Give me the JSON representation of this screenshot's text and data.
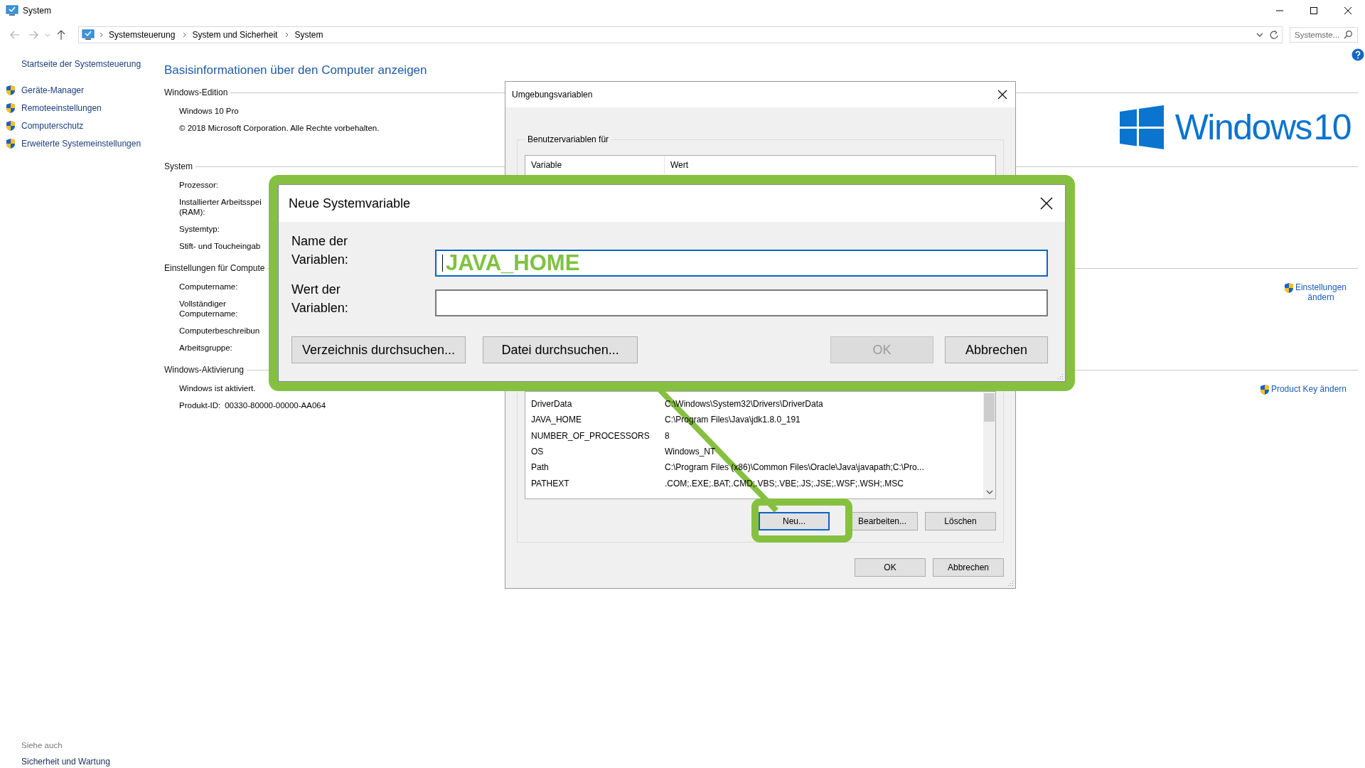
{
  "window": {
    "title": "System"
  },
  "address_bar": {
    "breadcrumbs": [
      "Systemsteuerung",
      "System und Sicherheit",
      "System"
    ]
  },
  "search": {
    "placeholder": "Systemste..."
  },
  "sidebar": {
    "home_link": "Startseite der Systemsteuerung",
    "items": [
      "Geräte-Manager",
      "Remoteeinstellungen",
      "Computerschutz",
      "Erweiterte Systemeinstellungen"
    ],
    "see_also": {
      "heading": "Siehe auch",
      "links": [
        "Sicherheit und Wartung"
      ]
    }
  },
  "main": {
    "heading": "Basisinformationen über den Computer anzeigen",
    "sections": [
      {
        "title": "Windows-Edition",
        "rows": [
          {
            "label": "Windows 10 Pro"
          },
          {
            "label": "© 2018 Microsoft Corporation. Alle Rechte vorbehalten."
          }
        ],
        "logo_text": "Windows 10"
      },
      {
        "title": "System",
        "rows": [
          {
            "label": "Prozessor:"
          },
          {
            "label": "Installierter Arbeitsspei\n(RAM):"
          },
          {
            "label": "Systemtyp:"
          },
          {
            "label": "Stift- und Toucheingab"
          }
        ]
      },
      {
        "title": "Einstellungen für Compute",
        "rows": [
          {
            "label": "Computername:"
          },
          {
            "label": "Vollständiger\nComputername:"
          },
          {
            "label": "Computerbeschreibun"
          },
          {
            "label": "Arbeitsgruppe:"
          }
        ],
        "link": "Einstellungen\nändern"
      },
      {
        "title": "Windows-Aktivierung",
        "rows": [
          {
            "label": "Windows ist aktiviert."
          },
          {
            "label": "Produkt-ID:",
            "value": "00330-80000-00000-AA064"
          }
        ],
        "link": "Product Key ändern"
      }
    ]
  },
  "env_dialog": {
    "title": "Umgebungsvariablen",
    "user_group": "Benutzervariablen für",
    "user_columns": [
      "Variable",
      "Wert"
    ],
    "system_rows": [
      {
        "variable": "DriverData",
        "value": "C:\\Windows\\System32\\Drivers\\DriverData"
      },
      {
        "variable": "JAVA_HOME",
        "value": "C:\\Program Files\\Java\\jdk1.8.0_191"
      },
      {
        "variable": "NUMBER_OF_PROCESSORS",
        "value": "8"
      },
      {
        "variable": "OS",
        "value": "Windows_NT"
      },
      {
        "variable": "Path",
        "value": "C:\\Program Files (x86)\\Common Files\\Oracle\\Java\\javapath;C:\\Pro..."
      },
      {
        "variable": "PATHEXT",
        "value": ".COM;.EXE;.BAT;.CMD;.VBS;.VBE;.JS;.JSE;.WSF;.WSH;.MSC"
      }
    ],
    "row_buttons": [
      {
        "label": "Neu...",
        "focused": true,
        "highlighted": true
      },
      {
        "label": "Bearbeiten...",
        "focused": false,
        "highlighted": false
      },
      {
        "label": "Löschen",
        "focused": false,
        "highlighted": false
      }
    ],
    "buttons": [
      "OK",
      "Abbrechen"
    ]
  },
  "new_dialog": {
    "title": "Neue Systemvariable",
    "highlighted": true,
    "fields": [
      {
        "label": "Name der\nVariablen:",
        "value": "JAVA_HOME",
        "focused": true
      },
      {
        "label": "Wert der\nVariablen:",
        "focused": false
      }
    ],
    "buttons": [
      {
        "label": "Verzeichnis durchsuchen...",
        "kind": "browse",
        "disabled": false
      },
      {
        "label": "Datei durchsuchen...",
        "kind": "browse",
        "disabled": false
      },
      {
        "label": "OK",
        "kind": "confirm",
        "disabled": true
      },
      {
        "label": "Abbrechen",
        "kind": "confirm",
        "disabled": false
      }
    ]
  }
}
